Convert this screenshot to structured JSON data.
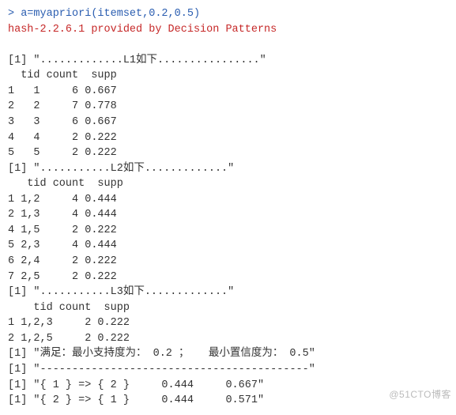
{
  "input": {
    "prompt": "> ",
    "code": "a=myapriori(itemset,0.2,0.5)"
  },
  "pkg_msg": "hash-2.2.6.1 provided by Decision Patterns",
  "blank": " ",
  "L1": {
    "title": "[1] \".............L1如下................\"",
    "header": "  tid count  supp",
    "rows": [
      "1   1     6 0.667",
      "2   2     7 0.778",
      "3   3     6 0.667",
      "4   4     2 0.222",
      "5   5     2 0.222"
    ]
  },
  "L2": {
    "title": "[1] \"...........L2如下.............\"",
    "header": "   tid count  supp",
    "rows": [
      "1 1,2     4 0.444",
      "2 1,3     4 0.444",
      "4 1,5     2 0.222",
      "5 2,3     4 0.444",
      "6 2,4     2 0.222",
      "7 2,5     2 0.222"
    ]
  },
  "L3": {
    "title": "[1] \"...........L3如下.............\"",
    "header": "    tid count  supp",
    "rows": [
      "1 1,2,3     2 0.222",
      "2 1,2,5     2 0.222"
    ]
  },
  "summary": "[1] \"满足：最小支持度为： 0.2 ；   最小置信度为： 0.5\"",
  "dashline": "[1] \"------------------------------------------\"",
  "rules": [
    "[1] \"{ 1 } => { 2 }     0.444     0.667\"",
    "[1] \"{ 2 } => { 1 }     0.444     0.571\""
  ],
  "watermark": "                   @51CTO博客",
  "chart_data": {
    "type": "table",
    "min_support": 0.2,
    "min_confidence": 0.5,
    "L1": [
      {
        "tid": "1",
        "count": 6,
        "supp": 0.667
      },
      {
        "tid": "2",
        "count": 7,
        "supp": 0.778
      },
      {
        "tid": "3",
        "count": 6,
        "supp": 0.667
      },
      {
        "tid": "4",
        "count": 2,
        "supp": 0.222
      },
      {
        "tid": "5",
        "count": 2,
        "supp": 0.222
      }
    ],
    "L2": [
      {
        "tid": "1,2",
        "count": 4,
        "supp": 0.444
      },
      {
        "tid": "1,3",
        "count": 4,
        "supp": 0.444
      },
      {
        "tid": "1,5",
        "count": 2,
        "supp": 0.222
      },
      {
        "tid": "2,3",
        "count": 4,
        "supp": 0.444
      },
      {
        "tid": "2,4",
        "count": 2,
        "supp": 0.222
      },
      {
        "tid": "2,5",
        "count": 2,
        "supp": 0.222
      }
    ],
    "L3": [
      {
        "tid": "1,2,3",
        "count": 2,
        "supp": 0.222
      },
      {
        "tid": "1,2,5",
        "count": 2,
        "supp": 0.222
      }
    ],
    "rules": [
      {
        "lhs": "{ 1 }",
        "rhs": "{ 2 }",
        "support": 0.444,
        "confidence": 0.667
      },
      {
        "lhs": "{ 2 }",
        "rhs": "{ 1 }",
        "support": 0.444,
        "confidence": 0.571
      }
    ]
  }
}
